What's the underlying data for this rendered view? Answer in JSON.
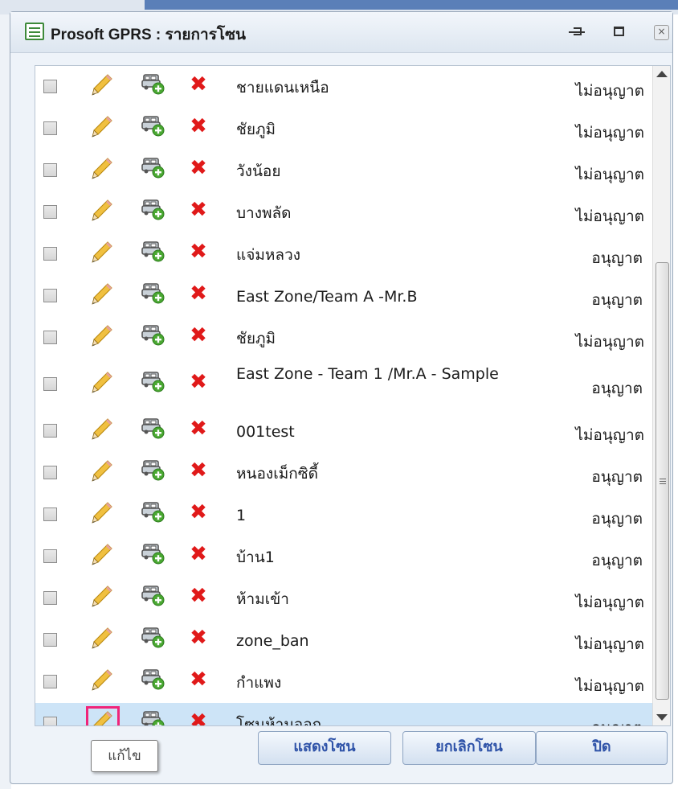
{
  "window": {
    "title": "Prosoft GPRS : รายการโซน",
    "close_glyph": "×"
  },
  "zones": [
    {
      "name": "ชายแดนเหนือ",
      "status": "ไม่อนุญาต",
      "allowed": false
    },
    {
      "name": "ชัยภูมิ",
      "status": "ไม่อนุญาต",
      "allowed": false
    },
    {
      "name": "วังน้อย",
      "status": "ไม่อนุญาต",
      "allowed": false
    },
    {
      "name": "บางพลัด",
      "status": "ไม่อนุญาต",
      "allowed": false
    },
    {
      "name": "แจ่มหลวง",
      "status": "อนุญาต",
      "allowed": true
    },
    {
      "name": "East Zone/Team A -Mr.B",
      "status": "อนุญาต",
      "allowed": true
    },
    {
      "name": "ชัยภูมิ",
      "status": "ไม่อนุญาต",
      "allowed": false
    },
    {
      "name": "East Zone - Team 1 /Mr.A - Sample",
      "status": "อนุญาต",
      "allowed": true
    },
    {
      "name": "001test",
      "status": "ไม่อนุญาต",
      "allowed": false
    },
    {
      "name": "หนองเม็กซิดี้",
      "status": "อนุญาต",
      "allowed": true
    },
    {
      "name": "1",
      "status": "อนุญาต",
      "allowed": true
    },
    {
      "name": "บ้าน1",
      "status": "อนุญาต",
      "allowed": true
    },
    {
      "name": "ห้ามเข้า",
      "status": "ไม่อนุญาต",
      "allowed": false
    },
    {
      "name": "zone_ban",
      "status": "ไม่อนุญาต",
      "allowed": false
    },
    {
      "name": "กำแพง",
      "status": "ไม่อนุญาต",
      "allowed": false
    },
    {
      "name": "โซนห้ามออก",
      "status": "อนุญาต",
      "allowed": true,
      "selected": true
    }
  ],
  "row_icons": {
    "edit": "pencil-icon",
    "vehicle": "car-add-icon",
    "delete_glyph": "✖"
  },
  "buttons": {
    "show_zone": "แสดงโซน",
    "cancel_zone": "ยกเลิกโซน",
    "close": "ปิด"
  },
  "tooltip": {
    "text": "แก้ไข"
  },
  "colors": {
    "delete": "#e01919",
    "selected_row": "#cde4f7",
    "highlight": "#f0247a",
    "button_text": "#2f53a8"
  }
}
